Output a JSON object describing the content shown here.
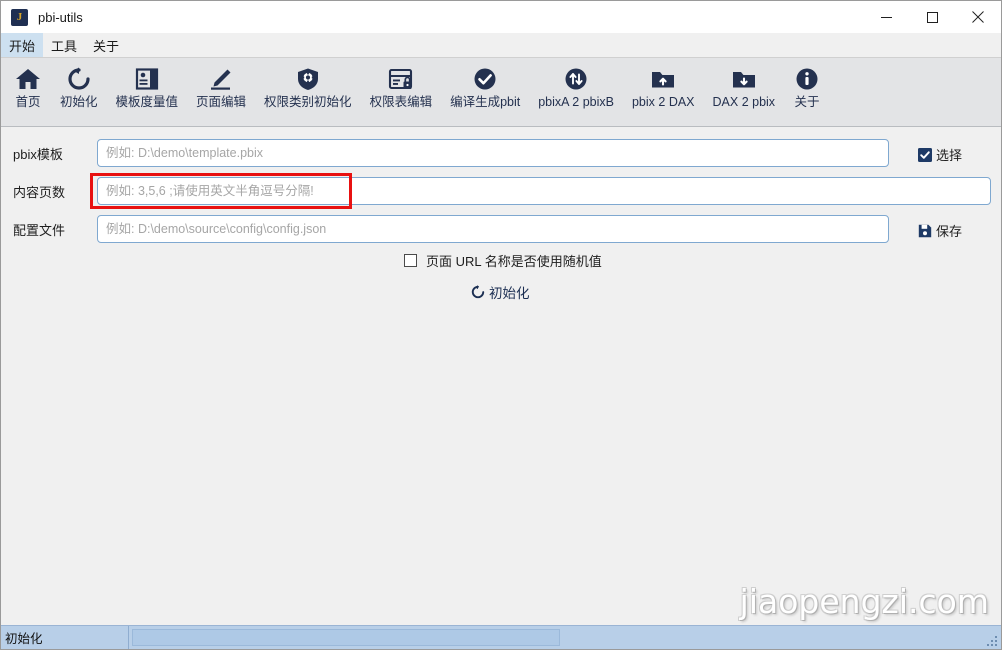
{
  "window": {
    "title": "pbi-utils",
    "app_icon": "j-letter-icon",
    "controls": {
      "minimize": "minimize-icon",
      "maximize": "maximize-icon",
      "close": "close-icon"
    }
  },
  "menubar": {
    "items": [
      {
        "label": "开始",
        "active": true
      },
      {
        "label": "工具",
        "active": false
      },
      {
        "label": "关于",
        "active": false
      }
    ]
  },
  "toolbar": {
    "buttons": [
      {
        "label": "首页",
        "icon": "home-icon"
      },
      {
        "label": "初始化",
        "icon": "refresh-counterclockwise-icon"
      },
      {
        "label": "模板度量值",
        "icon": "template-measure-panel-icon"
      },
      {
        "label": "页面编辑",
        "icon": "pencil-edit-icon"
      },
      {
        "label": "权限类别初始化",
        "icon": "shield-gear-icon"
      },
      {
        "label": "权限表编辑",
        "icon": "table-lock-icon"
      },
      {
        "label": "编译生成pbit",
        "icon": "check-circle-icon"
      },
      {
        "label": "pbixA 2 pbixB",
        "icon": "arrows-updown-circle-icon"
      },
      {
        "label": "pbix 2 DAX",
        "icon": "folder-upload-icon"
      },
      {
        "label": "DAX 2 pbix",
        "icon": "folder-download-icon"
      },
      {
        "label": "关于",
        "icon": "info-circle-icon"
      }
    ]
  },
  "form": {
    "fields": [
      {
        "label": "pbix模板",
        "value": "",
        "placeholder": "例如: D:\\demo\\template.pbix",
        "name": "pbix-template-input"
      },
      {
        "label": "内容页数",
        "value": "",
        "placeholder": "例如: 3,5,6 ;请使用英文半角逗号分隔!",
        "name": "content-pages-input"
      },
      {
        "label": "配置文件",
        "value": "",
        "placeholder": "例如: D:\\demo\\source\\config\\config.json",
        "name": "config-file-input"
      }
    ],
    "select_button": {
      "label": "选择",
      "icon": "checkbox-checked-icon"
    },
    "save_button": {
      "label": "保存",
      "icon": "floppy-save-icon"
    },
    "random_url_checkbox": {
      "label": "页面 URL 名称是否使用随机值",
      "checked": false
    },
    "init_button": {
      "label": "初始化",
      "icon": "refresh-counterclockwise-icon"
    }
  },
  "annotation": {
    "target": "content-pages-input",
    "color": "#e81111"
  },
  "watermark": {
    "text": "jiaopengzi.com"
  },
  "statusbar": {
    "status_text": "初始化",
    "progress_value": "",
    "grip": "resize-grip-icon"
  },
  "colors": {
    "accent_dark_navy": "#24314f",
    "toolbar_bg": "#e3e4e6",
    "window_bg": "#f0f0f0",
    "statusbar_bg": "#b8cfe8",
    "menu_active_bg": "#cde0f0",
    "input_border": "#7fa8d0",
    "annotation_red": "#e81111",
    "app_icon_gold": "#d4a32a"
  }
}
